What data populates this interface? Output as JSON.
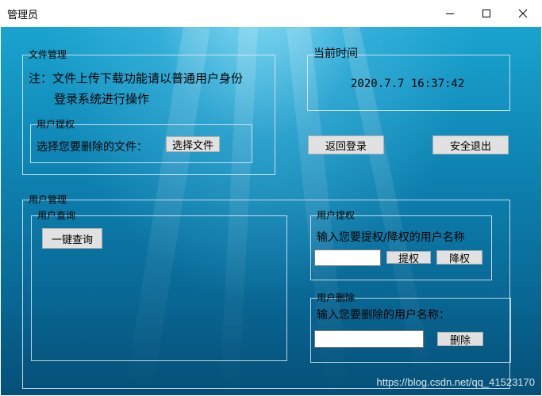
{
  "window": {
    "title": "管理员"
  },
  "controls": {
    "minimize": "minimize-icon",
    "maximize": "maximize-icon",
    "close": "close-icon"
  },
  "file_mgmt": {
    "title": "文件管理",
    "note_line1": "注：文件上传下载功能请以普通用户身份",
    "note_line2": "登录系统进行操作",
    "sub_title": "用户提权",
    "select_label": "选择您要删除的文件：",
    "select_button": "选择文件"
  },
  "time": {
    "title": "当前时间",
    "value": "2020.7.7 16:37:42"
  },
  "buttons": {
    "back_login": "返回登录",
    "safe_exit": "安全退出"
  },
  "user_mgmt": {
    "title": "用户管理",
    "query": {
      "title": "用户查询",
      "button": "一键查询"
    },
    "privilege": {
      "title": "用户提权",
      "prompt": "输入您要提权/降权的用户名称",
      "promote": "提权",
      "demote": "降权",
      "input_value": ""
    },
    "delete": {
      "title": "用户删除",
      "prompt": "输入您要删除的用户名称：",
      "button": "删除",
      "input_value": ""
    }
  },
  "watermark": "https://blog.csdn.net/qq_41523170"
}
